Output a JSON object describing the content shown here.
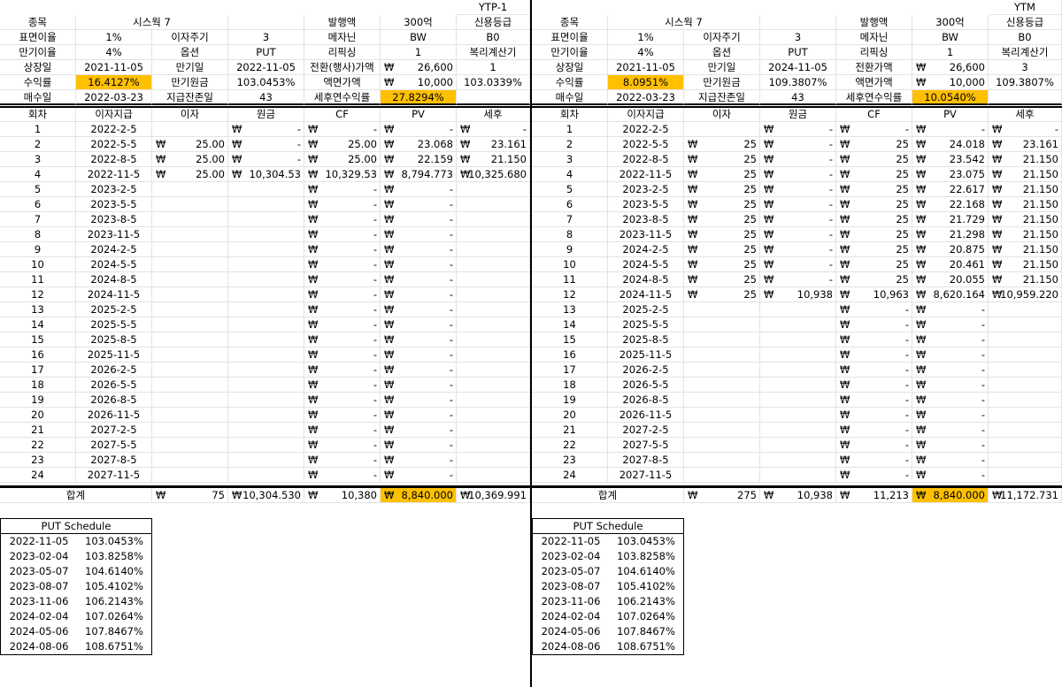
{
  "panels": [
    {
      "corner_label": "YTP-1",
      "info_rows": [
        [
          "종목",
          "시스웍 7",
          "",
          "발행액",
          "300억",
          "신용등급"
        ],
        [
          "표면이율",
          "1%",
          "이자주기",
          "3",
          "메자닌",
          "BW",
          "B0"
        ],
        [
          "만기이율",
          "4%",
          "옵션",
          "PUT",
          "리픽싱",
          "1",
          "복리계산기"
        ],
        [
          "상장일",
          "2021-11-05",
          "만기일",
          "2022-11-05",
          "전환(행사)가액",
          "26,600",
          "1"
        ],
        [
          "수익률",
          "16.4127%",
          "만기원금",
          "103.0453%",
          "액면가액",
          "10,000",
          "103.0339%"
        ],
        [
          "매수일",
          "2022-03-23",
          "지급잔존일",
          "43",
          "세후연수익률",
          "27.8294%",
          ""
        ]
      ],
      "headers": [
        "회차",
        "이자지급",
        "이자",
        "원금",
        "CF",
        "PV",
        "세후"
      ],
      "currency": "₩",
      "rows": [
        [
          "1",
          "2022-2-5",
          "",
          "-",
          "-",
          "-",
          "-"
        ],
        [
          "2",
          "2022-5-5",
          "25.00",
          "-",
          "25.00",
          "23.068",
          "23.161"
        ],
        [
          "3",
          "2022-8-5",
          "25.00",
          "-",
          "25.00",
          "22.159",
          "21.150"
        ],
        [
          "4",
          "2022-11-5",
          "25.00",
          "10,304.53",
          "10,329.53",
          "8,794.773",
          "10,325.680"
        ],
        [
          "5",
          "2023-2-5",
          "",
          "",
          "-",
          "-",
          ""
        ],
        [
          "6",
          "2023-5-5",
          "",
          "",
          "-",
          "-",
          ""
        ],
        [
          "7",
          "2023-8-5",
          "",
          "",
          "-",
          "-",
          ""
        ],
        [
          "8",
          "2023-11-5",
          "",
          "",
          "-",
          "-",
          ""
        ],
        [
          "9",
          "2024-2-5",
          "",
          "",
          "-",
          "-",
          ""
        ],
        [
          "10",
          "2024-5-5",
          "",
          "",
          "-",
          "-",
          ""
        ],
        [
          "11",
          "2024-8-5",
          "",
          "",
          "-",
          "-",
          ""
        ],
        [
          "12",
          "2024-11-5",
          "",
          "",
          "-",
          "-",
          ""
        ],
        [
          "13",
          "2025-2-5",
          "",
          "",
          "-",
          "-",
          ""
        ],
        [
          "14",
          "2025-5-5",
          "",
          "",
          "-",
          "-",
          ""
        ],
        [
          "15",
          "2025-8-5",
          "",
          "",
          "-",
          "-",
          ""
        ],
        [
          "16",
          "2025-11-5",
          "",
          "",
          "-",
          "-",
          ""
        ],
        [
          "17",
          "2026-2-5",
          "",
          "",
          "-",
          "-",
          ""
        ],
        [
          "18",
          "2026-5-5",
          "",
          "",
          "-",
          "-",
          ""
        ],
        [
          "19",
          "2026-8-5",
          "",
          "",
          "-",
          "-",
          ""
        ],
        [
          "20",
          "2026-11-5",
          "",
          "",
          "-",
          "-",
          ""
        ],
        [
          "21",
          "2027-2-5",
          "",
          "",
          "-",
          "-",
          ""
        ],
        [
          "22",
          "2027-5-5",
          "",
          "",
          "-",
          "-",
          ""
        ],
        [
          "23",
          "2027-8-5",
          "",
          "",
          "-",
          "-",
          ""
        ],
        [
          "24",
          "2027-11-5",
          "",
          "",
          "-",
          "-",
          ""
        ]
      ],
      "total": {
        "label": "합계",
        "interest": "75",
        "principal": "10,304.530",
        "cf": "10,380",
        "pv": "8,840.000",
        "after_tax": "10,369.991"
      },
      "put_schedule": {
        "title": "PUT Schedule",
        "rows": [
          [
            "2022-11-05",
            "103.0453%"
          ],
          [
            "2023-02-04",
            "103.8258%"
          ],
          [
            "2023-05-07",
            "104.6140%"
          ],
          [
            "2023-08-07",
            "105.4102%"
          ],
          [
            "2023-11-06",
            "106.2143%"
          ],
          [
            "2024-02-04",
            "107.0264%"
          ],
          [
            "2024-05-06",
            "107.8467%"
          ],
          [
            "2024-08-06",
            "108.6751%"
          ]
        ]
      }
    },
    {
      "corner_label": "YTM",
      "info_rows": [
        [
          "종목",
          "시스웍 7",
          "",
          "발행액",
          "300억",
          "신용등급"
        ],
        [
          "표면이율",
          "1%",
          "이자주기",
          "3",
          "메자닌",
          "BW",
          "B0"
        ],
        [
          "만기이율",
          "4%",
          "옵션",
          "PUT",
          "리픽싱",
          "1",
          "복리계산기"
        ],
        [
          "상장일",
          "2021-11-05",
          "만기일",
          "2024-11-05",
          "전환가액",
          "26,600",
          "3"
        ],
        [
          "수익률",
          "8.0951%",
          "만기원금",
          "109.3807%",
          "액면가액",
          "10,000",
          "109.3807%"
        ],
        [
          "매수일",
          "2022-03-23",
          "지급잔존일",
          "43",
          "세후연수익률",
          "10.0540%",
          ""
        ]
      ],
      "headers": [
        "회차",
        "이자지급",
        "이자",
        "원금",
        "CF",
        "PV",
        "세후"
      ],
      "currency": "₩",
      "rows": [
        [
          "1",
          "2022-2-5",
          "",
          "-",
          "-",
          "-",
          "-"
        ],
        [
          "2",
          "2022-5-5",
          "25",
          "-",
          "25",
          "24.018",
          "23.161"
        ],
        [
          "3",
          "2022-8-5",
          "25",
          "-",
          "25",
          "23.542",
          "21.150"
        ],
        [
          "4",
          "2022-11-5",
          "25",
          "-",
          "25",
          "23.075",
          "21.150"
        ],
        [
          "5",
          "2023-2-5",
          "25",
          "-",
          "25",
          "22.617",
          "21.150"
        ],
        [
          "6",
          "2023-5-5",
          "25",
          "-",
          "25",
          "22.168",
          "21.150"
        ],
        [
          "7",
          "2023-8-5",
          "25",
          "-",
          "25",
          "21.729",
          "21.150"
        ],
        [
          "8",
          "2023-11-5",
          "25",
          "-",
          "25",
          "21.298",
          "21.150"
        ],
        [
          "9",
          "2024-2-5",
          "25",
          "-",
          "25",
          "20.875",
          "21.150"
        ],
        [
          "10",
          "2024-5-5",
          "25",
          "-",
          "25",
          "20.461",
          "21.150"
        ],
        [
          "11",
          "2024-8-5",
          "25",
          "-",
          "25",
          "20.055",
          "21.150"
        ],
        [
          "12",
          "2024-11-5",
          "25",
          "10,938",
          "10,963",
          "8,620.164",
          "10,959.220"
        ],
        [
          "13",
          "2025-2-5",
          "",
          "",
          "-",
          "-",
          ""
        ],
        [
          "14",
          "2025-5-5",
          "",
          "",
          "-",
          "-",
          ""
        ],
        [
          "15",
          "2025-8-5",
          "",
          "",
          "-",
          "-",
          ""
        ],
        [
          "16",
          "2025-11-5",
          "",
          "",
          "-",
          "-",
          ""
        ],
        [
          "17",
          "2026-2-5",
          "",
          "",
          "-",
          "-",
          ""
        ],
        [
          "18",
          "2026-5-5",
          "",
          "",
          "-",
          "-",
          ""
        ],
        [
          "19",
          "2026-8-5",
          "",
          "",
          "-",
          "-",
          ""
        ],
        [
          "20",
          "2026-11-5",
          "",
          "",
          "-",
          "-",
          ""
        ],
        [
          "21",
          "2027-2-5",
          "",
          "",
          "-",
          "-",
          ""
        ],
        [
          "22",
          "2027-5-5",
          "",
          "",
          "-",
          "-",
          ""
        ],
        [
          "23",
          "2027-8-5",
          "",
          "",
          "-",
          "-",
          ""
        ],
        [
          "24",
          "2027-11-5",
          "",
          "",
          "-",
          "-",
          ""
        ]
      ],
      "total": {
        "label": "합계",
        "interest": "275",
        "principal": "10,938",
        "cf": "11,213",
        "pv": "8,840.000",
        "after_tax": "11,172.731"
      },
      "put_schedule": {
        "title": "PUT Schedule",
        "rows": [
          [
            "2022-11-05",
            "103.0453%"
          ],
          [
            "2023-02-04",
            "103.8258%"
          ],
          [
            "2023-05-07",
            "104.6140%"
          ],
          [
            "2023-08-07",
            "105.4102%"
          ],
          [
            "2023-11-06",
            "106.2143%"
          ],
          [
            "2024-02-04",
            "107.0264%"
          ],
          [
            "2024-05-06",
            "107.8467%"
          ],
          [
            "2024-08-06",
            "108.6751%"
          ]
        ]
      }
    }
  ]
}
